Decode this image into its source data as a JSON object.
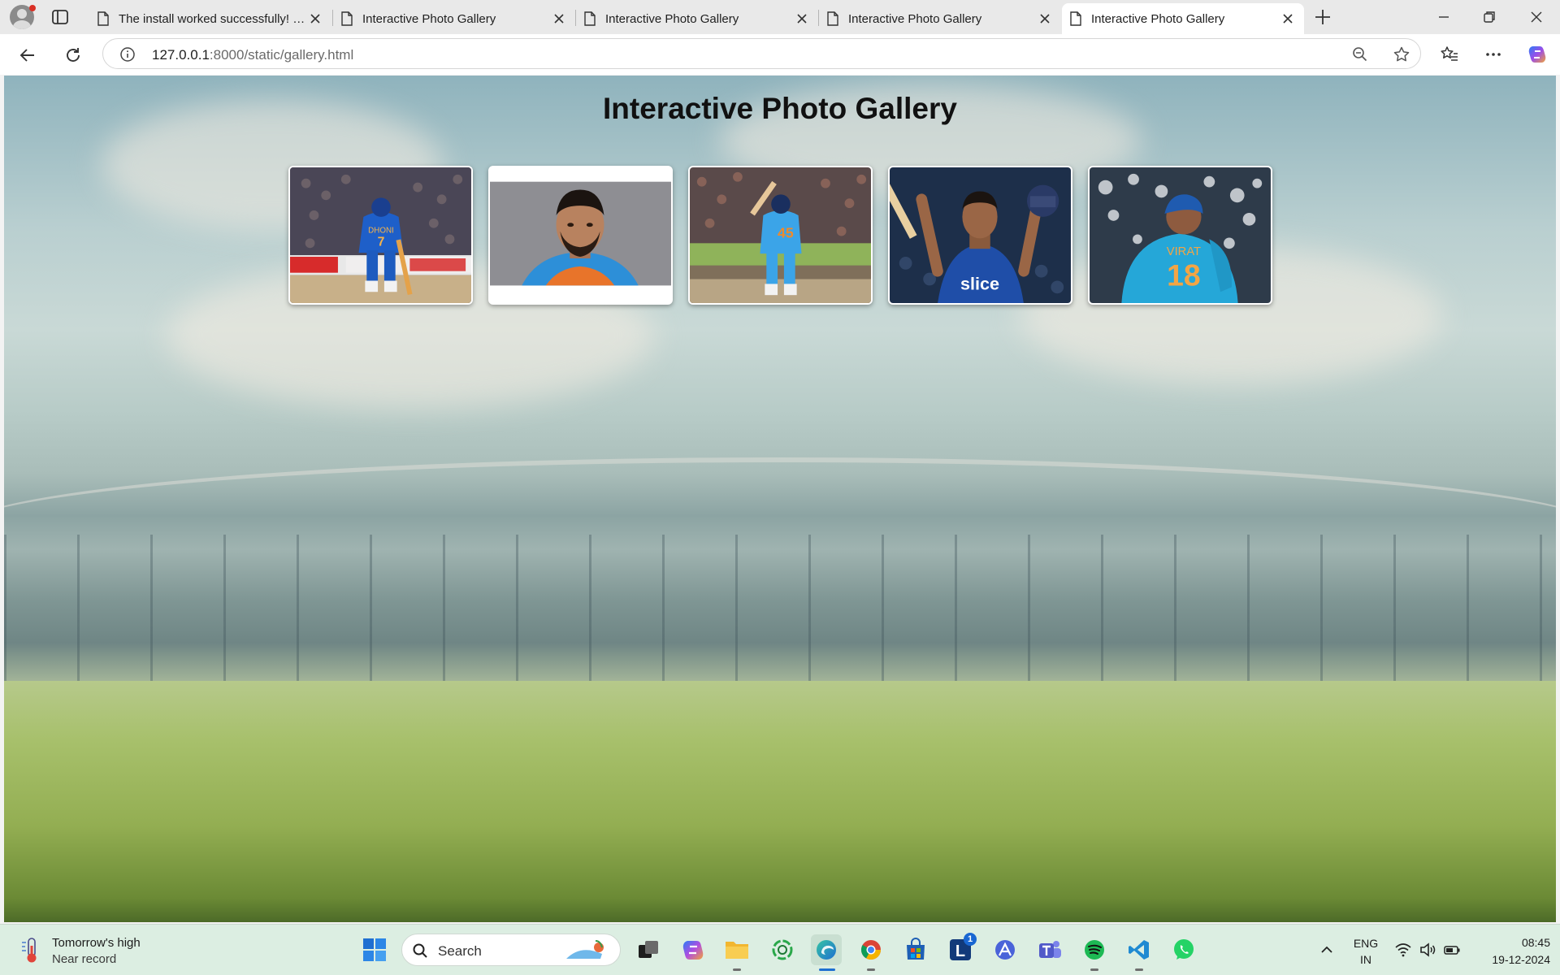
{
  "browser": {
    "tabs": [
      {
        "title": "The install worked successfully! Congratulations!",
        "active": false
      },
      {
        "title": "Interactive Photo Gallery",
        "active": false
      },
      {
        "title": "Interactive Photo Gallery",
        "active": false
      },
      {
        "title": "Interactive Photo Gallery",
        "active": false
      },
      {
        "title": "Interactive Photo Gallery",
        "active": true
      }
    ],
    "url_host": "127.0.0.1",
    "url_rest": ":8000/static/gallery.html"
  },
  "page": {
    "heading": "Interactive Photo Gallery",
    "photos": [
      {
        "subject": "player in blue jersey number 7 walking out to bat",
        "jersey_text": "DHONI 7",
        "background": "stadium crowd"
      },
      {
        "subject": "portrait of player in blue and orange jersey",
        "background": "grey studio"
      },
      {
        "subject": "batter raising bat, blue jersey number 45",
        "jersey_text": "45",
        "background": "stadium crowd"
      },
      {
        "subject": "batter celebrating with helmet raised, blue jersey",
        "jersey_text": "slice",
        "background": "dark stadium"
      },
      {
        "subject": "player seen from behind, blue jersey number 18",
        "jersey_text": "VIRAT 18",
        "background": "stadium lights bokeh"
      }
    ]
  },
  "taskbar": {
    "weather_title": "Tomorrow's high",
    "weather_sub": "Near record",
    "search_label": "Search",
    "apps": [
      "start",
      "search",
      "task-view",
      "copilot",
      "file-explorer",
      "green-circle-app",
      "edge",
      "chrome",
      "store",
      "l-app",
      "a-app",
      "teams",
      "spotify",
      "vscode",
      "whatsapp"
    ],
    "l_app_badge": "1",
    "lang_top": "ENG",
    "lang_bottom": "IN",
    "time": "08:45",
    "date": "19-12-2024"
  },
  "colors": {
    "taskbar_bg": "#dceee2",
    "tab_strip_bg": "#e9e9e9",
    "india_blue": "#1e6fd9"
  }
}
